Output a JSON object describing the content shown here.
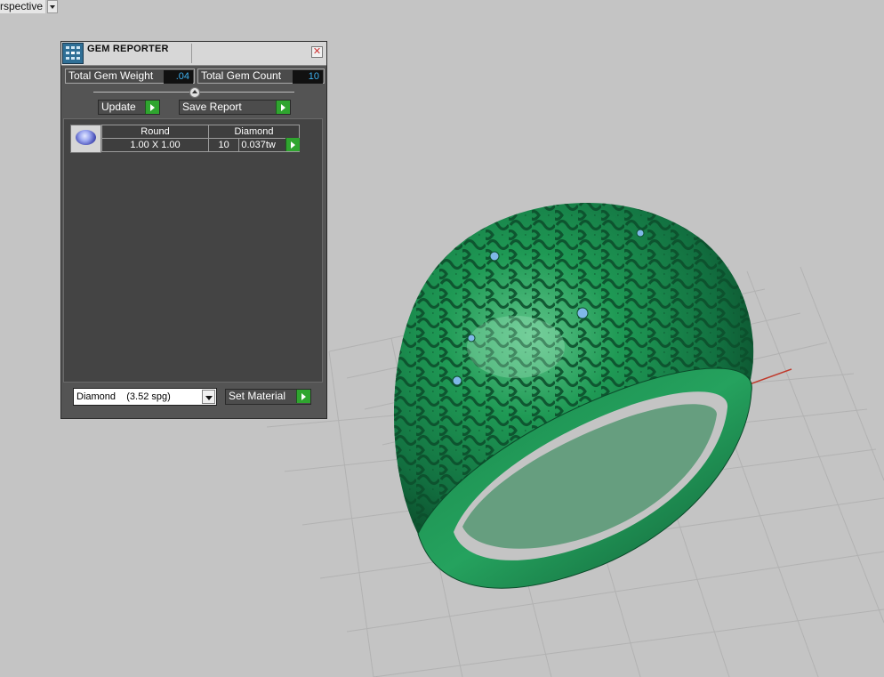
{
  "viewport": {
    "label": "rspective",
    "menu_icon": "chevron-down-icon",
    "model": "ring",
    "model_color": "#1f8a4d",
    "grid_color": "#b0b0b0",
    "axis_x_color": "#c0392b",
    "axis_y_color": "#2e9b47"
  },
  "panel": {
    "title": "GEM REPORTER",
    "close_icon": "close-icon",
    "app_icon": "gem-reporter-icon",
    "total_weight_label": "Total Gem Weight",
    "total_weight_value": ".04",
    "total_count_label": "Total Gem Count",
    "total_count_value": "10",
    "update_label": "Update",
    "save_report_label": "Save Report",
    "gems": [
      {
        "shape": "Round",
        "material": "Diamond",
        "size": "1.00 X 1.00",
        "count": "10",
        "weight": "0.037tw"
      }
    ],
    "material_select": "Diamond    (3.52 spg)",
    "set_material_label": "Set Material"
  }
}
